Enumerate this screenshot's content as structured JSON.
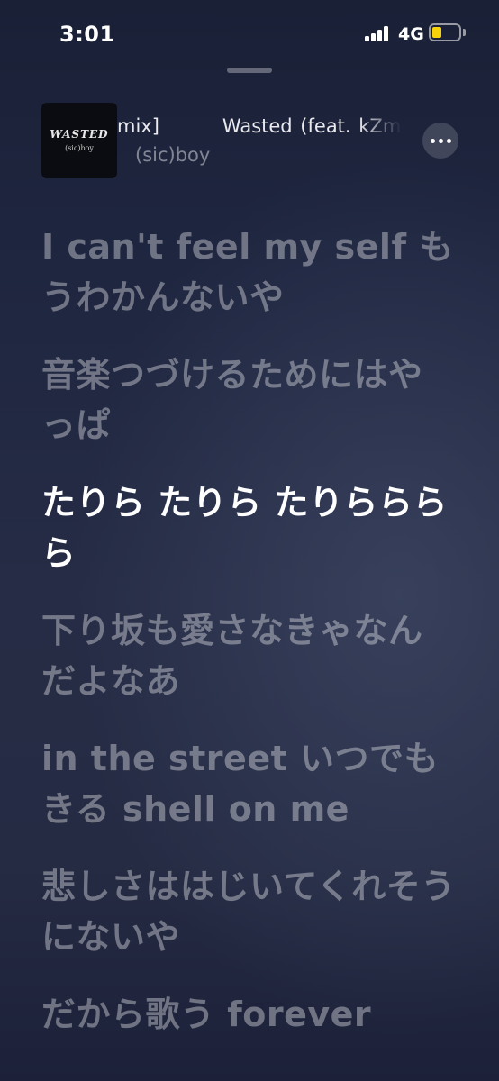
{
  "status_bar": {
    "time": "3:01",
    "network": "4G",
    "battery_color": "#f5d20a"
  },
  "now_playing": {
    "artwork_title": "WASTED",
    "artwork_subtitle": "(sic)boy",
    "title_tail": "mix]",
    "title": "Wasted (feat. kZm &",
    "artist": "(sic)boy"
  },
  "lyrics": [
    {
      "text": "I can't feel my self もうわかんないや",
      "active": false
    },
    {
      "text": "音楽つづけるためにはやっぱ",
      "active": false
    },
    {
      "text": "たりら たりら たりらららら",
      "active": true
    },
    {
      "text": "下り坂も愛さなきゃなんだよなあ",
      "active": false
    },
    {
      "text": "in the street いつでもきる shell on me",
      "active": false
    },
    {
      "text": "悲しさははじいてくれそうにないや",
      "active": false
    },
    {
      "text": "だから歌う forever",
      "active": false
    }
  ],
  "colors": {
    "lyric_active": "#ffffff",
    "lyric_inactive": "rgba(255,255,255,0.36)",
    "background": "#1f2640"
  }
}
